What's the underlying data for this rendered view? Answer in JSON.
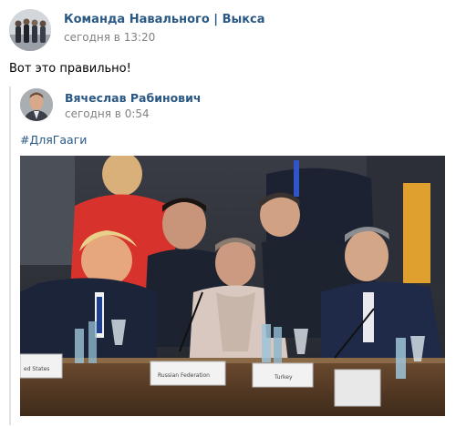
{
  "post": {
    "author": "Команда Навального | Выкса",
    "time": "сегодня в 13:20",
    "text": "Вот это правильно!"
  },
  "repost": {
    "author": "Вячеслав Рабинович",
    "time": "сегодня в 0:54",
    "hashtag": "#ДляГааги"
  },
  "photo": {
    "placards": [
      "ed States",
      "Russian Federation",
      "Turkey"
    ]
  }
}
